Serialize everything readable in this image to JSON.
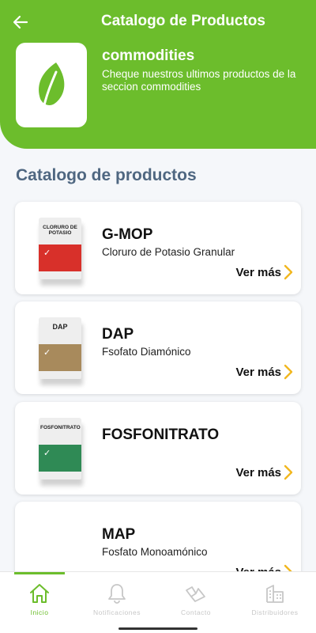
{
  "header": {
    "title": "Catalogo de Productos",
    "category_name": "commodities",
    "category_description": "Cheque nuestros ultimos productos de la seccion commodities",
    "accent_color": "#6cbd2c"
  },
  "section_title": "Catalogo de productos",
  "products": [
    {
      "name": "G-MOP",
      "description": "Cloruro de Potasio Granular",
      "bag_label": "CLORURO DE POTASIO",
      "bag_color": "#d8302a",
      "action_label": "Ver más"
    },
    {
      "name": "DAP",
      "description": "Fsofato Diamónico",
      "bag_label": "DAP",
      "bag_color": "#a88a5c",
      "action_label": "Ver más"
    },
    {
      "name": "FOSFONITRATO",
      "description": "",
      "bag_label": "FOSFONITRATO",
      "bag_color": "#2f8a55",
      "action_label": "Ver más"
    },
    {
      "name": "MAP",
      "description": "Fosfato Monoamónico",
      "action_label": "Ver más"
    }
  ],
  "nav": {
    "items": [
      {
        "label": "Inicio",
        "icon": "home-icon",
        "active": true
      },
      {
        "label": "Notificaciones",
        "icon": "bell-icon",
        "active": false
      },
      {
        "label": "Contacto",
        "icon": "contact-icon",
        "active": false
      },
      {
        "label": "Distribuidores",
        "icon": "building-icon",
        "active": false
      }
    ]
  }
}
